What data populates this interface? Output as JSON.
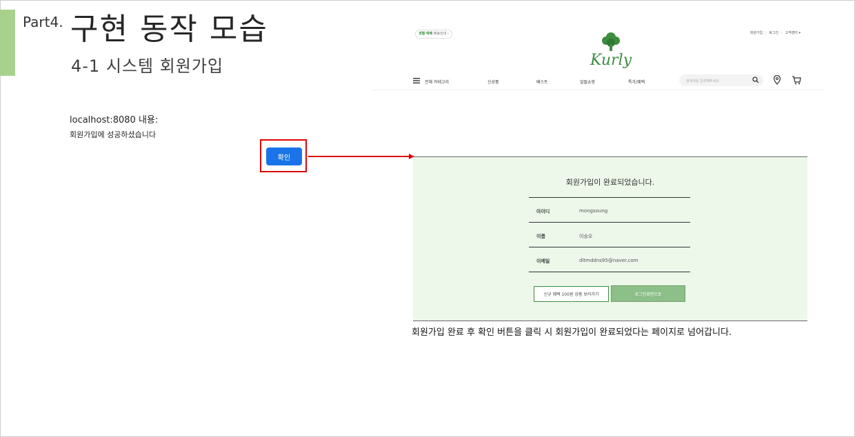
{
  "slide": {
    "part_label": "Part4.",
    "title": "구현 동작 모습",
    "subtitle": "4-1 시스템 회원가입",
    "caption": "회원가입 완료 후 확인 버튼을 클릭 시 회원가입이 완료되었다는 페이지로 넘어갑니다.",
    "accent_color": "#a9d18e"
  },
  "alert_dialog": {
    "title": "localhost:8080 내용:",
    "message": "회원가입에 성공하셨습니다",
    "ok_label": "확인",
    "ok_color": "#1a73e8",
    "highlight_color": "#e00000"
  },
  "kurly_header": {
    "shipping_badge_strong": "샛별·택배",
    "shipping_badge_rest": "배송안내 ›",
    "logo_text": "Kurly",
    "top_links": [
      "회원가입",
      "로그인",
      "고객센터 ▾"
    ],
    "nav": {
      "all_category": "전체 카테고리",
      "items": [
        "신상품",
        "베스트",
        "알뜰쇼핑",
        "특가/혜택"
      ]
    },
    "search_placeholder": "검색어를 입력해주세요"
  },
  "signup_complete": {
    "title": "회원가입이 완료되었습니다.",
    "rows": [
      {
        "label": "아이디",
        "value": "mongsoung"
      },
      {
        "label": "이름",
        "value": "이승오"
      },
      {
        "label": "이메일",
        "value": "dltmddns95@naver.com"
      }
    ],
    "secondary_button": "신규 혜택 100원 상품 보러가기",
    "primary_button": "로그인화면으로",
    "panel_color": "#edf7ea"
  }
}
